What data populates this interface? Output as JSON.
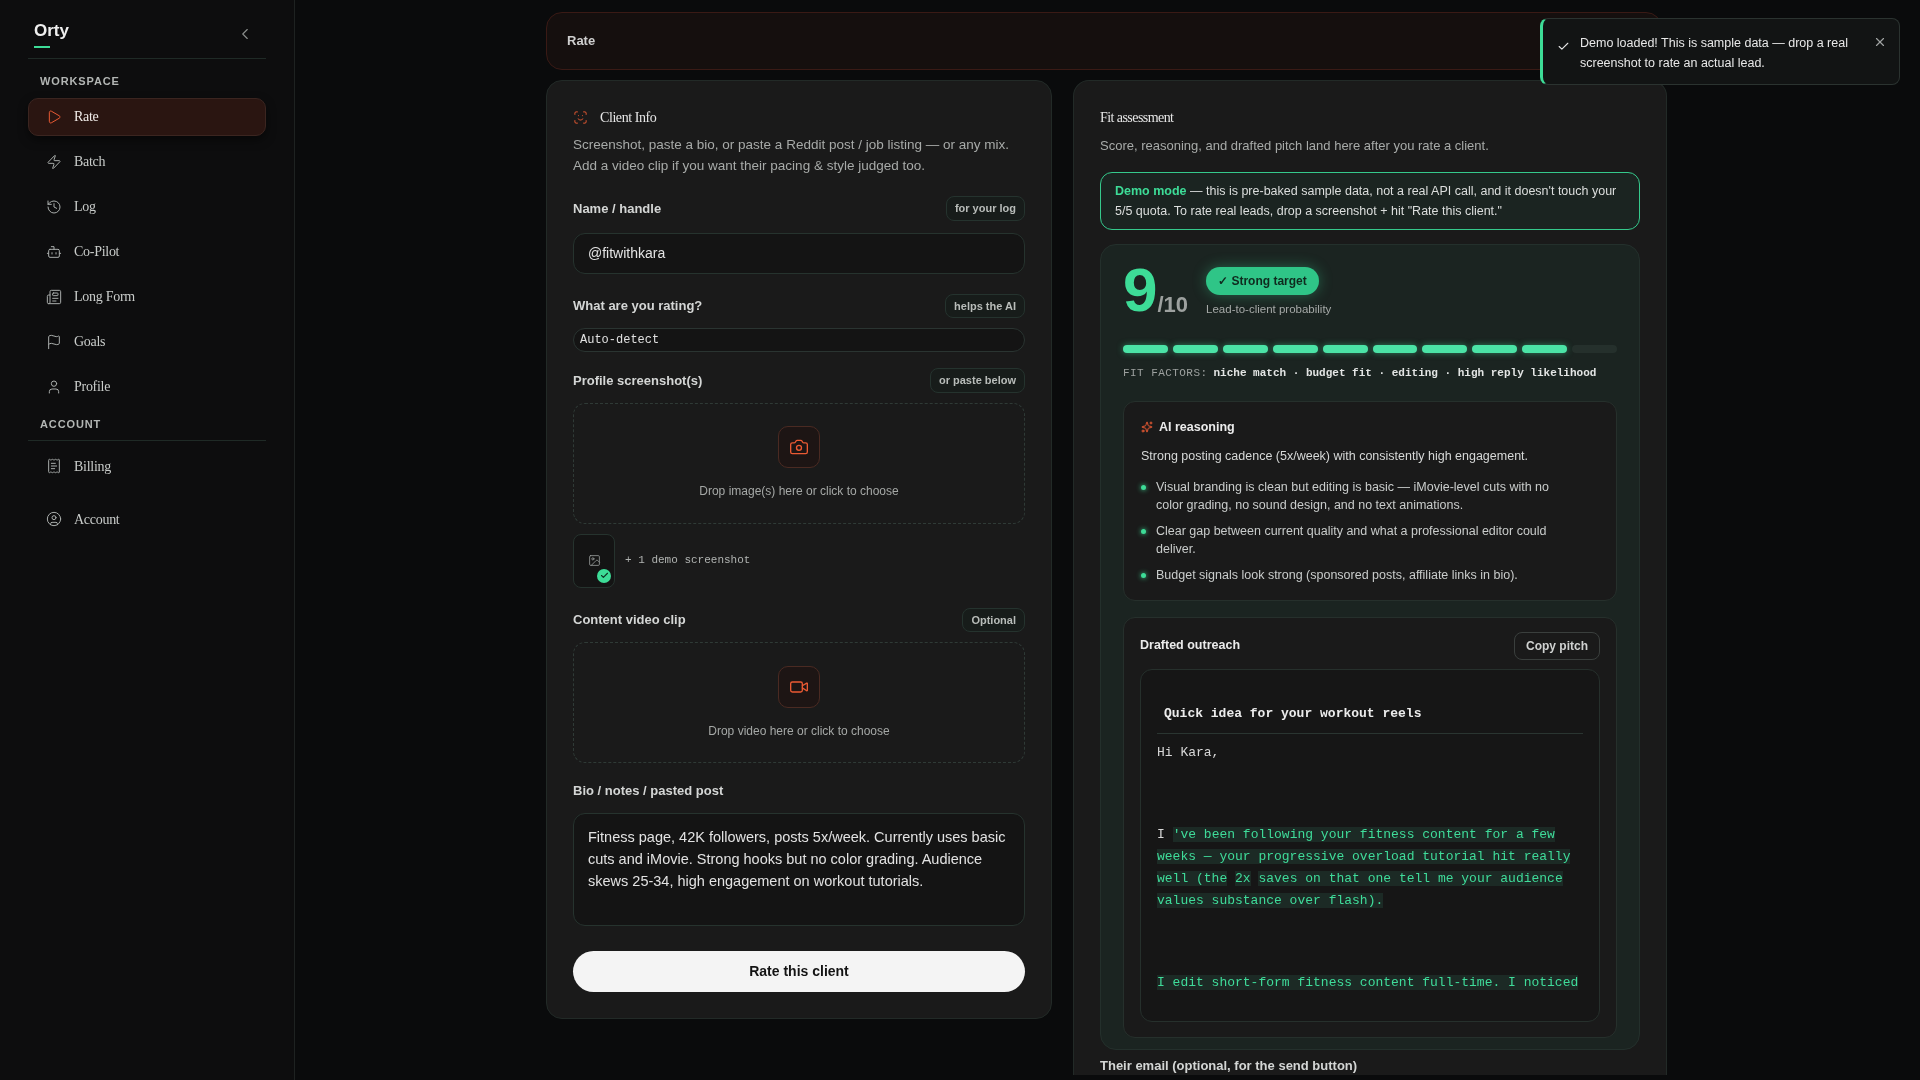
{
  "sidebar": {
    "brand": "Orty",
    "sections": [
      {
        "title": "WORKSPACE",
        "items": [
          {
            "label": "Rate",
            "selected": true
          },
          {
            "label": "Batch",
            "selected": false
          },
          {
            "label": "Log",
            "selected": false
          },
          {
            "label": "Co-Pilot",
            "selected": false
          },
          {
            "label": "Long Form",
            "selected": false
          },
          {
            "label": "Goals",
            "selected": false
          },
          {
            "label": "Profile",
            "selected": false
          }
        ]
      },
      {
        "title": "ACCOUNT",
        "items": [
          {
            "label": "Billing",
            "selected": false
          },
          {
            "label": "Account",
            "selected": false
          }
        ]
      }
    ]
  },
  "topbar": {
    "title": "Rate"
  },
  "toast": {
    "message": "Demo loaded! This is sample data — drop a real screenshot to rate an actual lead."
  },
  "client_info": {
    "title": "Client Info",
    "description": "Screenshot, paste a bio, or paste a Reddit post / job listing — or any mix. Add a video clip if you want their pacing & style judged too.",
    "name": {
      "label": "Name / handle",
      "tag": "for your log",
      "value": "@fitwithkara"
    },
    "rating": {
      "label": "What are you rating?",
      "tag": "helps the AI",
      "value": "Auto-detect"
    },
    "screenshots": {
      "label": "Profile screenshot(s)",
      "tag": "or paste below",
      "drop_text": "Drop image(s) here or click to choose",
      "attachment": "+ 1 demo screenshot"
    },
    "video": {
      "label": "Content video clip",
      "tag": "Optional",
      "drop_text": "Drop video here or click to choose"
    },
    "bio": {
      "label": "Bio / notes / pasted post",
      "value": "Fitness page, 42K followers, posts 5x/week. Currently uses basic cuts and iMovie. Strong hooks but no color grading. Audience skews 25-34, high engagement on workout tutorials."
    },
    "submit": "Rate this client"
  },
  "fit_assessment": {
    "title": "Fit assessment",
    "description": "Score, reasoning, and drafted pitch land here after you rate a client.",
    "notice": {
      "lead": "Demo mode",
      "text": " — this is pre-baked sample data, not a real API call, and it doesn't touch your 5/5 quota. To rate real leads, drop a screenshot + hit \"Rate this client.\""
    },
    "score": {
      "value": "9",
      "out_of": "/10",
      "badge": "✓ Strong target",
      "caption": "Lead-to-client probability",
      "segments": [
        {
          "filled": true
        },
        {
          "filled": true
        },
        {
          "filled": true
        },
        {
          "filled": true
        },
        {
          "filled": true
        },
        {
          "filled": true
        },
        {
          "filled": true
        },
        {
          "filled": true
        },
        {
          "filled": true
        },
        {
          "filled": false
        }
      ],
      "factors_label": "FIT FACTORS:",
      "factors": "niche match · budget fit · editing · high reply likelihood"
    },
    "reasoning": {
      "title": "AI reasoning",
      "summary": "Strong posting cadence (5x/week) with consistently high engagement.",
      "points": [
        "Visual branding is clean but editing is basic — iMovie-level cuts with no color grading, no sound design, and no text animations.",
        "Clear gap between current quality and what a professional editor could deliver.",
        "Budget signals look strong (sponsored posts, affiliate links in bio)."
      ]
    },
    "outreach": {
      "title": "Drafted outreach",
      "copy_button": "Copy pitch",
      "subject": "Quick idea for your workout reels",
      "paragraphs": [
        [
          {
            "text": "Hi Kara,",
            "highlighted": false
          }
        ],
        [
          {
            "text": "I",
            "highlighted": false
          },
          {
            "text": "'ve been following your fitness content for a few weeks — your progressive overload tutorial hit really well (the",
            "highlighted": true
          },
          {
            "text": "2x",
            "highlighted": true
          },
          {
            "text": "saves on that one tell me your audience values substance over flash).",
            "highlighted": true
          }
        ],
        [
          {
            "text": "I edit short-form fitness content full-time. I noticed",
            "highlighted": true
          }
        ]
      ]
    },
    "email_label": "Their email (optional, for the send button)"
  }
}
